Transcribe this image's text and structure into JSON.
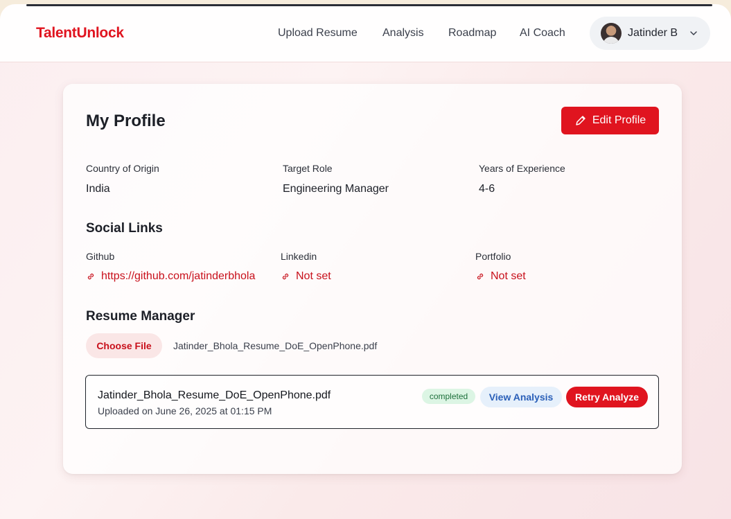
{
  "brand": {
    "name": "TalentUnlock",
    "color": "#e0141f"
  },
  "nav": {
    "links": [
      {
        "label": "Upload Resume"
      },
      {
        "label": "Analysis"
      },
      {
        "label": "Roadmap"
      },
      {
        "label": "AI Coach"
      }
    ],
    "user": {
      "name": "Jatinder B",
      "avatar_icon": "user-avatar",
      "menu_icon": "chevron-down-icon"
    }
  },
  "profile": {
    "title": "My Profile",
    "edit_label": "Edit Profile",
    "edit_icon": "pencil-icon",
    "fields": [
      {
        "label": "Country of Origin",
        "value": "India"
      },
      {
        "label": "Target Role",
        "value": "Engineering Manager"
      },
      {
        "label": "Years of Experience",
        "value": "4-6"
      }
    ]
  },
  "social": {
    "title": "Social Links",
    "link_icon": "link-icon",
    "links": [
      {
        "label": "Github",
        "value": "https://github.com/jatinderbhola"
      },
      {
        "label": "Linkedin",
        "value": "Not set"
      },
      {
        "label": "Portfolio",
        "value": "Not set"
      }
    ]
  },
  "resume": {
    "title": "Resume Manager",
    "choose_label": "Choose File",
    "chosen_file": "Jatinder_Bhola_Resume_DoE_OpenPhone.pdf",
    "items": [
      {
        "name": "Jatinder_Bhola_Resume_DoE_OpenPhone.pdf",
        "uploaded": "Uploaded on June 26, 2025 at 01:15 PM",
        "status": "completed",
        "view_label": "View Analysis",
        "retry_label": "Retry Analyze"
      }
    ]
  }
}
